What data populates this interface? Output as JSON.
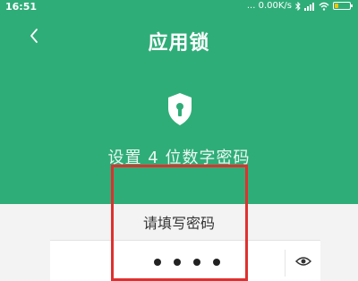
{
  "status_bar": {
    "time": "16:51",
    "network": "... 0.00K/s",
    "battery_level": 0.25
  },
  "header": {
    "title": "应用锁",
    "back_icon": "chevron-left-icon"
  },
  "hero": {
    "icon": "shield-keyhole-icon",
    "subtitle": "设置 4 位数字密码"
  },
  "pin": {
    "prompt": "请填写密码",
    "digits_entered": 4,
    "digits_total": 4,
    "toggle_icon": "eye-icon"
  },
  "colors": {
    "primary": "#2fad78",
    "highlight": "#e0302e",
    "battery": "#f5c400"
  }
}
